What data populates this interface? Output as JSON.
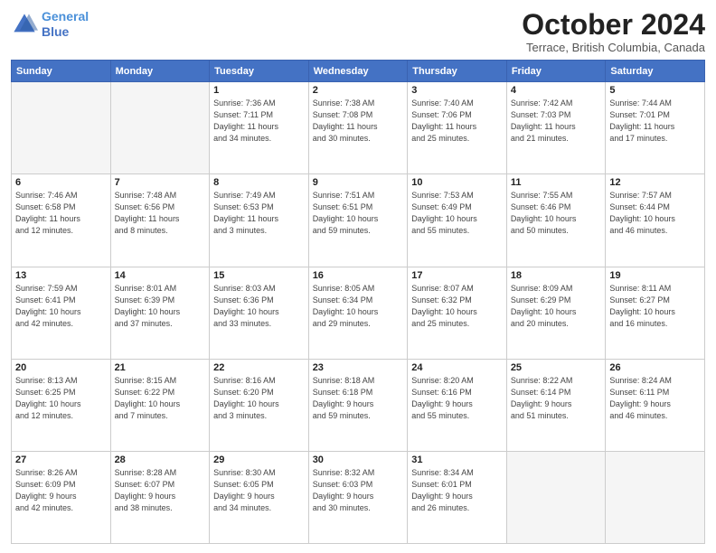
{
  "header": {
    "logo_line1": "General",
    "logo_line2": "Blue",
    "month": "October 2024",
    "location": "Terrace, British Columbia, Canada"
  },
  "days_of_week": [
    "Sunday",
    "Monday",
    "Tuesday",
    "Wednesday",
    "Thursday",
    "Friday",
    "Saturday"
  ],
  "weeks": [
    [
      {
        "day": "",
        "info": ""
      },
      {
        "day": "",
        "info": ""
      },
      {
        "day": "1",
        "info": "Sunrise: 7:36 AM\nSunset: 7:11 PM\nDaylight: 11 hours\nand 34 minutes."
      },
      {
        "day": "2",
        "info": "Sunrise: 7:38 AM\nSunset: 7:08 PM\nDaylight: 11 hours\nand 30 minutes."
      },
      {
        "day": "3",
        "info": "Sunrise: 7:40 AM\nSunset: 7:06 PM\nDaylight: 11 hours\nand 25 minutes."
      },
      {
        "day": "4",
        "info": "Sunrise: 7:42 AM\nSunset: 7:03 PM\nDaylight: 11 hours\nand 21 minutes."
      },
      {
        "day": "5",
        "info": "Sunrise: 7:44 AM\nSunset: 7:01 PM\nDaylight: 11 hours\nand 17 minutes."
      }
    ],
    [
      {
        "day": "6",
        "info": "Sunrise: 7:46 AM\nSunset: 6:58 PM\nDaylight: 11 hours\nand 12 minutes."
      },
      {
        "day": "7",
        "info": "Sunrise: 7:48 AM\nSunset: 6:56 PM\nDaylight: 11 hours\nand 8 minutes."
      },
      {
        "day": "8",
        "info": "Sunrise: 7:49 AM\nSunset: 6:53 PM\nDaylight: 11 hours\nand 3 minutes."
      },
      {
        "day": "9",
        "info": "Sunrise: 7:51 AM\nSunset: 6:51 PM\nDaylight: 10 hours\nand 59 minutes."
      },
      {
        "day": "10",
        "info": "Sunrise: 7:53 AM\nSunset: 6:49 PM\nDaylight: 10 hours\nand 55 minutes."
      },
      {
        "day": "11",
        "info": "Sunrise: 7:55 AM\nSunset: 6:46 PM\nDaylight: 10 hours\nand 50 minutes."
      },
      {
        "day": "12",
        "info": "Sunrise: 7:57 AM\nSunset: 6:44 PM\nDaylight: 10 hours\nand 46 minutes."
      }
    ],
    [
      {
        "day": "13",
        "info": "Sunrise: 7:59 AM\nSunset: 6:41 PM\nDaylight: 10 hours\nand 42 minutes."
      },
      {
        "day": "14",
        "info": "Sunrise: 8:01 AM\nSunset: 6:39 PM\nDaylight: 10 hours\nand 37 minutes."
      },
      {
        "day": "15",
        "info": "Sunrise: 8:03 AM\nSunset: 6:36 PM\nDaylight: 10 hours\nand 33 minutes."
      },
      {
        "day": "16",
        "info": "Sunrise: 8:05 AM\nSunset: 6:34 PM\nDaylight: 10 hours\nand 29 minutes."
      },
      {
        "day": "17",
        "info": "Sunrise: 8:07 AM\nSunset: 6:32 PM\nDaylight: 10 hours\nand 25 minutes."
      },
      {
        "day": "18",
        "info": "Sunrise: 8:09 AM\nSunset: 6:29 PM\nDaylight: 10 hours\nand 20 minutes."
      },
      {
        "day": "19",
        "info": "Sunrise: 8:11 AM\nSunset: 6:27 PM\nDaylight: 10 hours\nand 16 minutes."
      }
    ],
    [
      {
        "day": "20",
        "info": "Sunrise: 8:13 AM\nSunset: 6:25 PM\nDaylight: 10 hours\nand 12 minutes."
      },
      {
        "day": "21",
        "info": "Sunrise: 8:15 AM\nSunset: 6:22 PM\nDaylight: 10 hours\nand 7 minutes."
      },
      {
        "day": "22",
        "info": "Sunrise: 8:16 AM\nSunset: 6:20 PM\nDaylight: 10 hours\nand 3 minutes."
      },
      {
        "day": "23",
        "info": "Sunrise: 8:18 AM\nSunset: 6:18 PM\nDaylight: 9 hours\nand 59 minutes."
      },
      {
        "day": "24",
        "info": "Sunrise: 8:20 AM\nSunset: 6:16 PM\nDaylight: 9 hours\nand 55 minutes."
      },
      {
        "day": "25",
        "info": "Sunrise: 8:22 AM\nSunset: 6:14 PM\nDaylight: 9 hours\nand 51 minutes."
      },
      {
        "day": "26",
        "info": "Sunrise: 8:24 AM\nSunset: 6:11 PM\nDaylight: 9 hours\nand 46 minutes."
      }
    ],
    [
      {
        "day": "27",
        "info": "Sunrise: 8:26 AM\nSunset: 6:09 PM\nDaylight: 9 hours\nand 42 minutes."
      },
      {
        "day": "28",
        "info": "Sunrise: 8:28 AM\nSunset: 6:07 PM\nDaylight: 9 hours\nand 38 minutes."
      },
      {
        "day": "29",
        "info": "Sunrise: 8:30 AM\nSunset: 6:05 PM\nDaylight: 9 hours\nand 34 minutes."
      },
      {
        "day": "30",
        "info": "Sunrise: 8:32 AM\nSunset: 6:03 PM\nDaylight: 9 hours\nand 30 minutes."
      },
      {
        "day": "31",
        "info": "Sunrise: 8:34 AM\nSunset: 6:01 PM\nDaylight: 9 hours\nand 26 minutes."
      },
      {
        "day": "",
        "info": ""
      },
      {
        "day": "",
        "info": ""
      }
    ]
  ]
}
